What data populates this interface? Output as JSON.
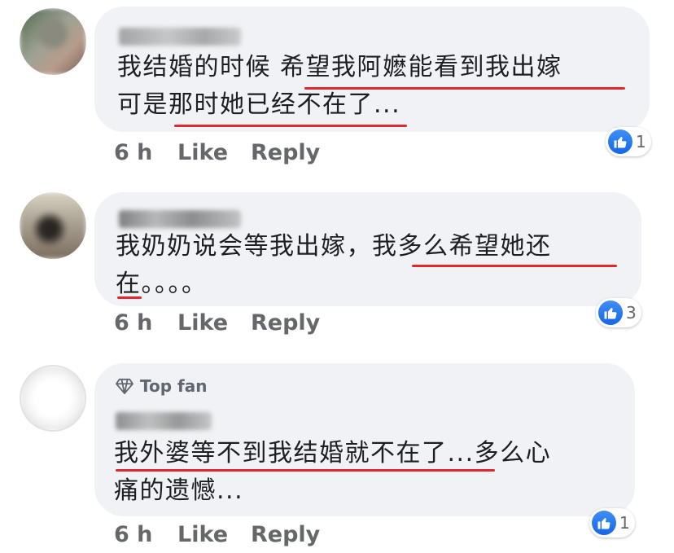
{
  "comments": [
    {
      "text_line1": "我结婚的时候 希望我阿嬷能看到我出嫁",
      "text_line2": "可是那时她已经不在了...",
      "time": "6 h",
      "like_label": "Like",
      "reply_label": "Reply",
      "reaction_count": "1"
    },
    {
      "text_line1": "我奶奶说会等我出嫁，我多么希望她还",
      "text_line2": "在。。。。",
      "time": "6 h",
      "like_label": "Like",
      "reply_label": "Reply",
      "reaction_count": "3"
    },
    {
      "badge": "Top fan",
      "text_line1": "我外婆等不到我结婚就不在了...多么心",
      "text_line2": "痛的遗憾...",
      "time": "6 h",
      "like_label": "Like",
      "reply_label": "Reply",
      "reaction_count": "1"
    }
  ],
  "colors": {
    "bubble": "#f0f2f5",
    "underline": "#e0262f",
    "like_blue": "#1877f2",
    "meta_gray": "#65676b"
  },
  "icons": [
    "thumbs-up-icon",
    "diamond-icon"
  ]
}
